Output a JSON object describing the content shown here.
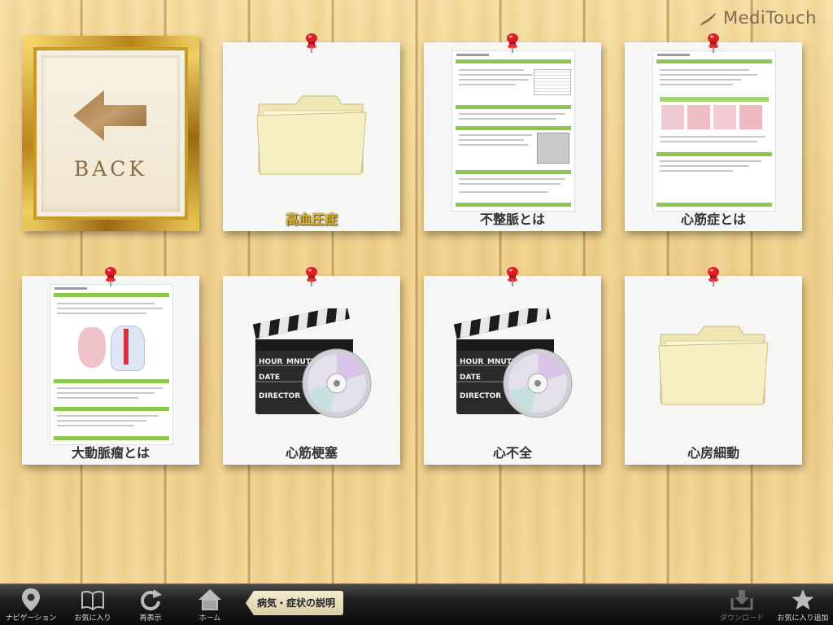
{
  "app": {
    "logo_text": "MediTouch",
    "back_label": "BACK"
  },
  "cards": [
    {
      "label": "高血圧症",
      "kind": "folder",
      "selected": true
    },
    {
      "label": "不整脈とは",
      "kind": "document"
    },
    {
      "label": "心筋症とは",
      "kind": "document"
    },
    {
      "label": "大動脈瘤とは",
      "kind": "document"
    },
    {
      "label": "心筋梗塞",
      "kind": "video"
    },
    {
      "label": "心不全",
      "kind": "video"
    },
    {
      "label": "心房細動",
      "kind": "folder"
    }
  ],
  "clapboard": {
    "hour": "HOUR",
    "minute": "MNUTE",
    "date": "DATE",
    "director": "DIRECTOR"
  },
  "toolbar": {
    "navigation": "ナビゲーション",
    "favorites": "お気に入り",
    "redisplay": "再表示",
    "home": "ホーム",
    "breadcrumb": "病気・症状の説明",
    "download": "ダウンロード",
    "add_favorite": "お気に入り追加"
  },
  "colors": {
    "accent_green": "#8cc84b",
    "frame_gold": "#d4a62a",
    "pin_red": "#d8202a",
    "selected_label": "#d8b33c"
  }
}
